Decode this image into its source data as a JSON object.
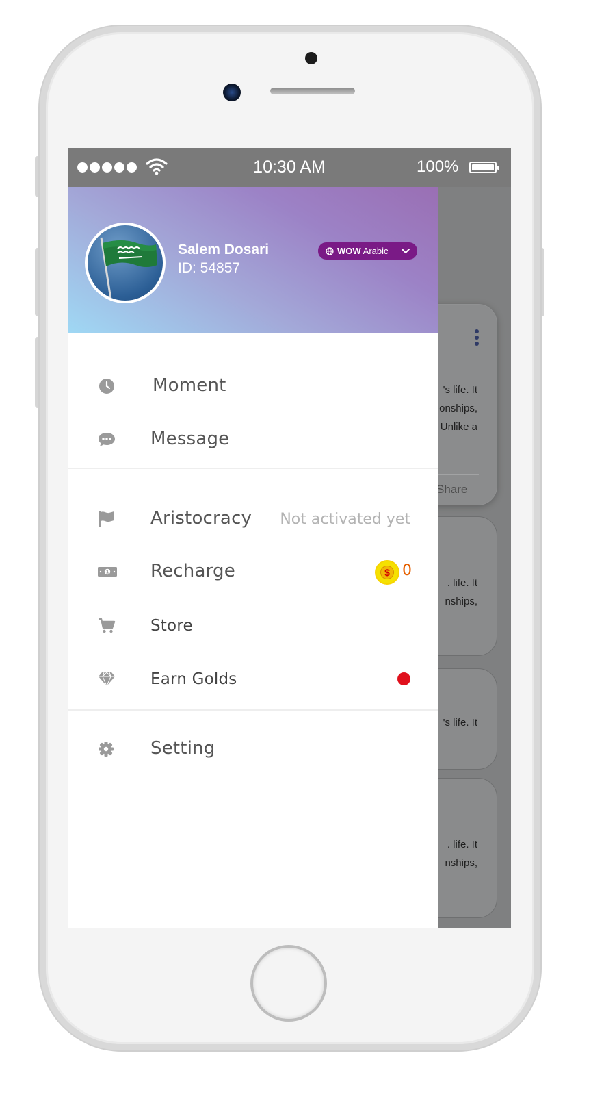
{
  "status_bar": {
    "time": "10:30 AM",
    "battery_percent": "100%",
    "signal_bars": 5,
    "wifi_icon": "wifi-icon",
    "battery_icon": "battery-icon"
  },
  "profile": {
    "name": "Salem Dosari",
    "id_text": "ID: 54857",
    "avatar_icon": "saudi-flag-avatar",
    "language_pill": {
      "brand": "WOW",
      "language": "Arabic",
      "icon": "globe-icon",
      "chevron_icon": "chevron-down-icon"
    }
  },
  "menu": {
    "group1": [
      {
        "label": "Moment",
        "icon": "clock-icon"
      },
      {
        "label": "Message",
        "icon": "chat-bubble-icon"
      }
    ],
    "group2": [
      {
        "label": "Aristocracy",
        "icon": "flag-icon",
        "status": "Not activated yet"
      },
      {
        "label": "Recharge",
        "icon": "cash-icon",
        "coin_count": "0",
        "coin_icon": "dollar-coin-icon"
      },
      {
        "label": "Store",
        "icon": "cart-icon"
      },
      {
        "label": "Earn Golds",
        "icon": "diamond-icon",
        "has_notification": true
      }
    ],
    "group3": [
      {
        "label": "Setting",
        "icon": "gear-icon"
      }
    ]
  },
  "background_feed": {
    "cards": [
      {
        "lines": [
          "'s life. It",
          "onships,",
          "Unlike a"
        ],
        "action": "Share"
      },
      {
        "lines": [
          ". life. It",
          "nships,"
        ]
      },
      {
        "lines": [
          "'s life. It"
        ]
      },
      {
        "lines": [
          ". life. It",
          "nships,"
        ]
      }
    ]
  },
  "colors": {
    "header_gradient_start": "#9fd8f4",
    "header_gradient_end": "#9a6fb4",
    "language_pill": "#7a1a86",
    "coin_count": "#e66000",
    "notification_dot": "#e0101c",
    "muted_status": "#b3b3b3"
  }
}
